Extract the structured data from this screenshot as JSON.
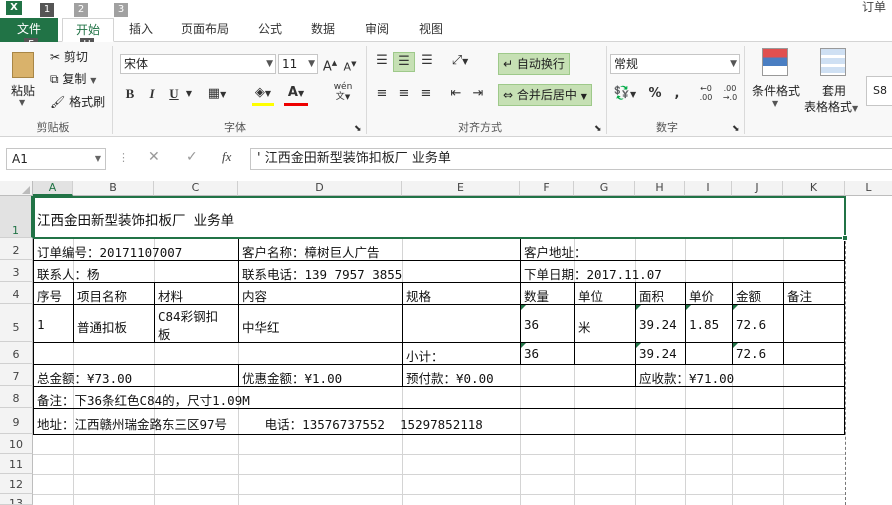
{
  "window": {
    "title_right": "订单"
  },
  "keytips": {
    "one": "1",
    "two": "2",
    "three": "3",
    "f": "F",
    "h": "H"
  },
  "tabs": [
    "文件",
    "开始",
    "插入",
    "页面布局",
    "公式",
    "数据",
    "审阅",
    "视图"
  ],
  "ribbon": {
    "clipboard": {
      "paste": "粘贴",
      "cut": "剪切",
      "copy": "复制",
      "painter": "格式刷",
      "label": "剪贴板"
    },
    "font": {
      "name": "宋体",
      "size": "11",
      "label": "字体",
      "bold": "B",
      "italic": "I",
      "underline": "U",
      "wen": "wén"
    },
    "alignment": {
      "wrap": "自动换行",
      "merge": "合并后居中",
      "label": "对齐方式"
    },
    "number": {
      "format": "常规",
      "label": "数字",
      "percent": "%",
      "comma": ","
    },
    "styles": {
      "cond": "条件格式",
      "table1": "套用",
      "table2": "表格格式",
      "cellstyle": "S8"
    }
  },
  "formula_bar": {
    "namebox": "A1",
    "fx": "fx",
    "content": "' 江西金田新型装饰扣板厂  业务单"
  },
  "columns": [
    "A",
    "B",
    "C",
    "D",
    "E",
    "F",
    "G",
    "H",
    "I",
    "J",
    "K",
    "L"
  ],
  "rows": [
    "1",
    "2",
    "3",
    "4",
    "5",
    "6",
    "7",
    "8",
    "9",
    "10",
    "11",
    "12",
    "13"
  ],
  "sheet": {
    "r1": "江西金田新型装饰扣板厂  业务单",
    "r2": {
      "order_no": "订单编号：20171107007",
      "customer": "客户名称：樟树巨人广告",
      "address": "客户地址："
    },
    "r3": {
      "contact": "联系人：杨",
      "phone": "联系电话：139 7957 3855",
      "date": "下单日期：2017.11.07"
    },
    "r4": {
      "seq": "序号",
      "item": "项目名称",
      "material": "材料",
      "content": "内容",
      "spec": "规格",
      "qty": "数量",
      "unit": "单位",
      "area": "面积",
      "price": "单价",
      "amount": "金额",
      "note": "备注"
    },
    "r5": {
      "seq": "1",
      "item": "普通扣板",
      "material_1": "C84彩钢扣",
      "material_2": "板",
      "content": "中华红",
      "qty": "36",
      "unit": "米",
      "area": "39.24",
      "price": "1.85",
      "amount": "72.6"
    },
    "r6": {
      "subtotal": "小计：",
      "qty": "36",
      "area": "39.24",
      "amount": "72.6"
    },
    "r7": {
      "total": "总金额：¥73.00",
      "discount": "优惠金额：¥1.00",
      "prepaid": "预付款：¥0.00",
      "receivable": "应收款：¥71.00"
    },
    "r8": "备注：下36条红色C84的，尺寸1.09M",
    "r9": "地址：江西赣州瑞金路东三区97号     电话：13576737552  15297852118"
  }
}
